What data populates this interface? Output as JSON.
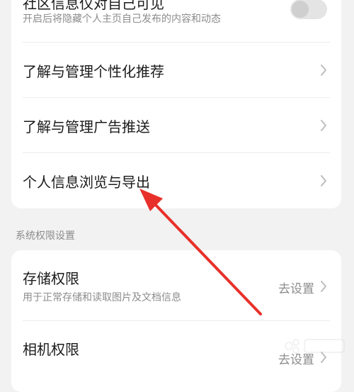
{
  "community_visibility": {
    "title": "社区信息仅对自己可见",
    "subtitle": "开启后将隐藏个人主页自己发布的内容和动态",
    "enabled": false
  },
  "menu_items": [
    {
      "label": "了解与管理个性化推荐",
      "icon": "chevron-right-icon"
    },
    {
      "label": "了解与管理广告推送",
      "icon": "chevron-right-icon"
    },
    {
      "label": "个人信息浏览与导出",
      "icon": "chevron-right-icon"
    }
  ],
  "system_permissions": {
    "section_label": "系统权限设置",
    "items": [
      {
        "title": "存储权限",
        "subtitle": "用于正常存储和读取图片及文档信息",
        "action_label": "去设置"
      },
      {
        "title": "相机权限",
        "action_label": "去设置"
      }
    ]
  },
  "annotation": {
    "arrow_color": "#e8302a"
  }
}
